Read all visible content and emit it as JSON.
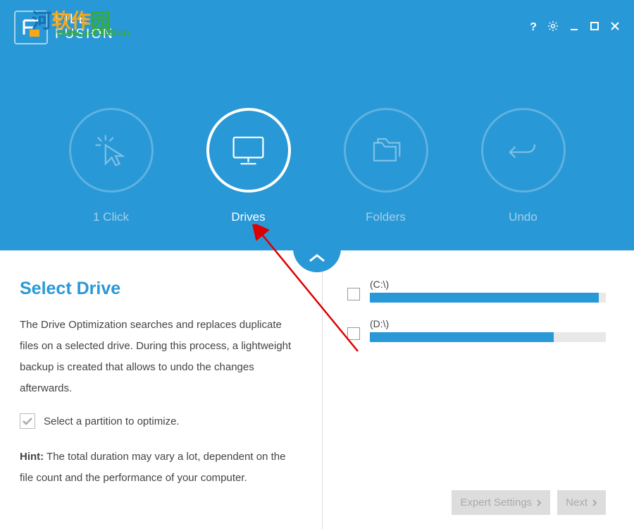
{
  "app": {
    "name_line1": "FILE",
    "name_line2": "FUSION"
  },
  "watermark": {
    "char1": "河",
    "char2": "软作",
    "char3": "园",
    "url": "www.pc0359.cn"
  },
  "nav": {
    "steps": [
      {
        "label": "1 Click"
      },
      {
        "label": "Drives"
      },
      {
        "label": "Folders"
      },
      {
        "label": "Undo"
      }
    ]
  },
  "left": {
    "title": "Select Drive",
    "desc": "The Drive Optimization searches and replaces duplicate files on a selected drive. During this process, a lightweight backup is created that allows to undo the changes afterwards.",
    "checkbox_label": "Select a partition to optimize.",
    "hint_prefix": "Hint:",
    "hint_text": " The total duration may vary a lot, dependent on the file count and the performance of your computer."
  },
  "drives": [
    {
      "label": "(C:\\)",
      "fill": 97
    },
    {
      "label": "(D:\\)",
      "fill": 78
    }
  ],
  "buttons": {
    "expert": "Expert Settings",
    "next": "Next"
  }
}
